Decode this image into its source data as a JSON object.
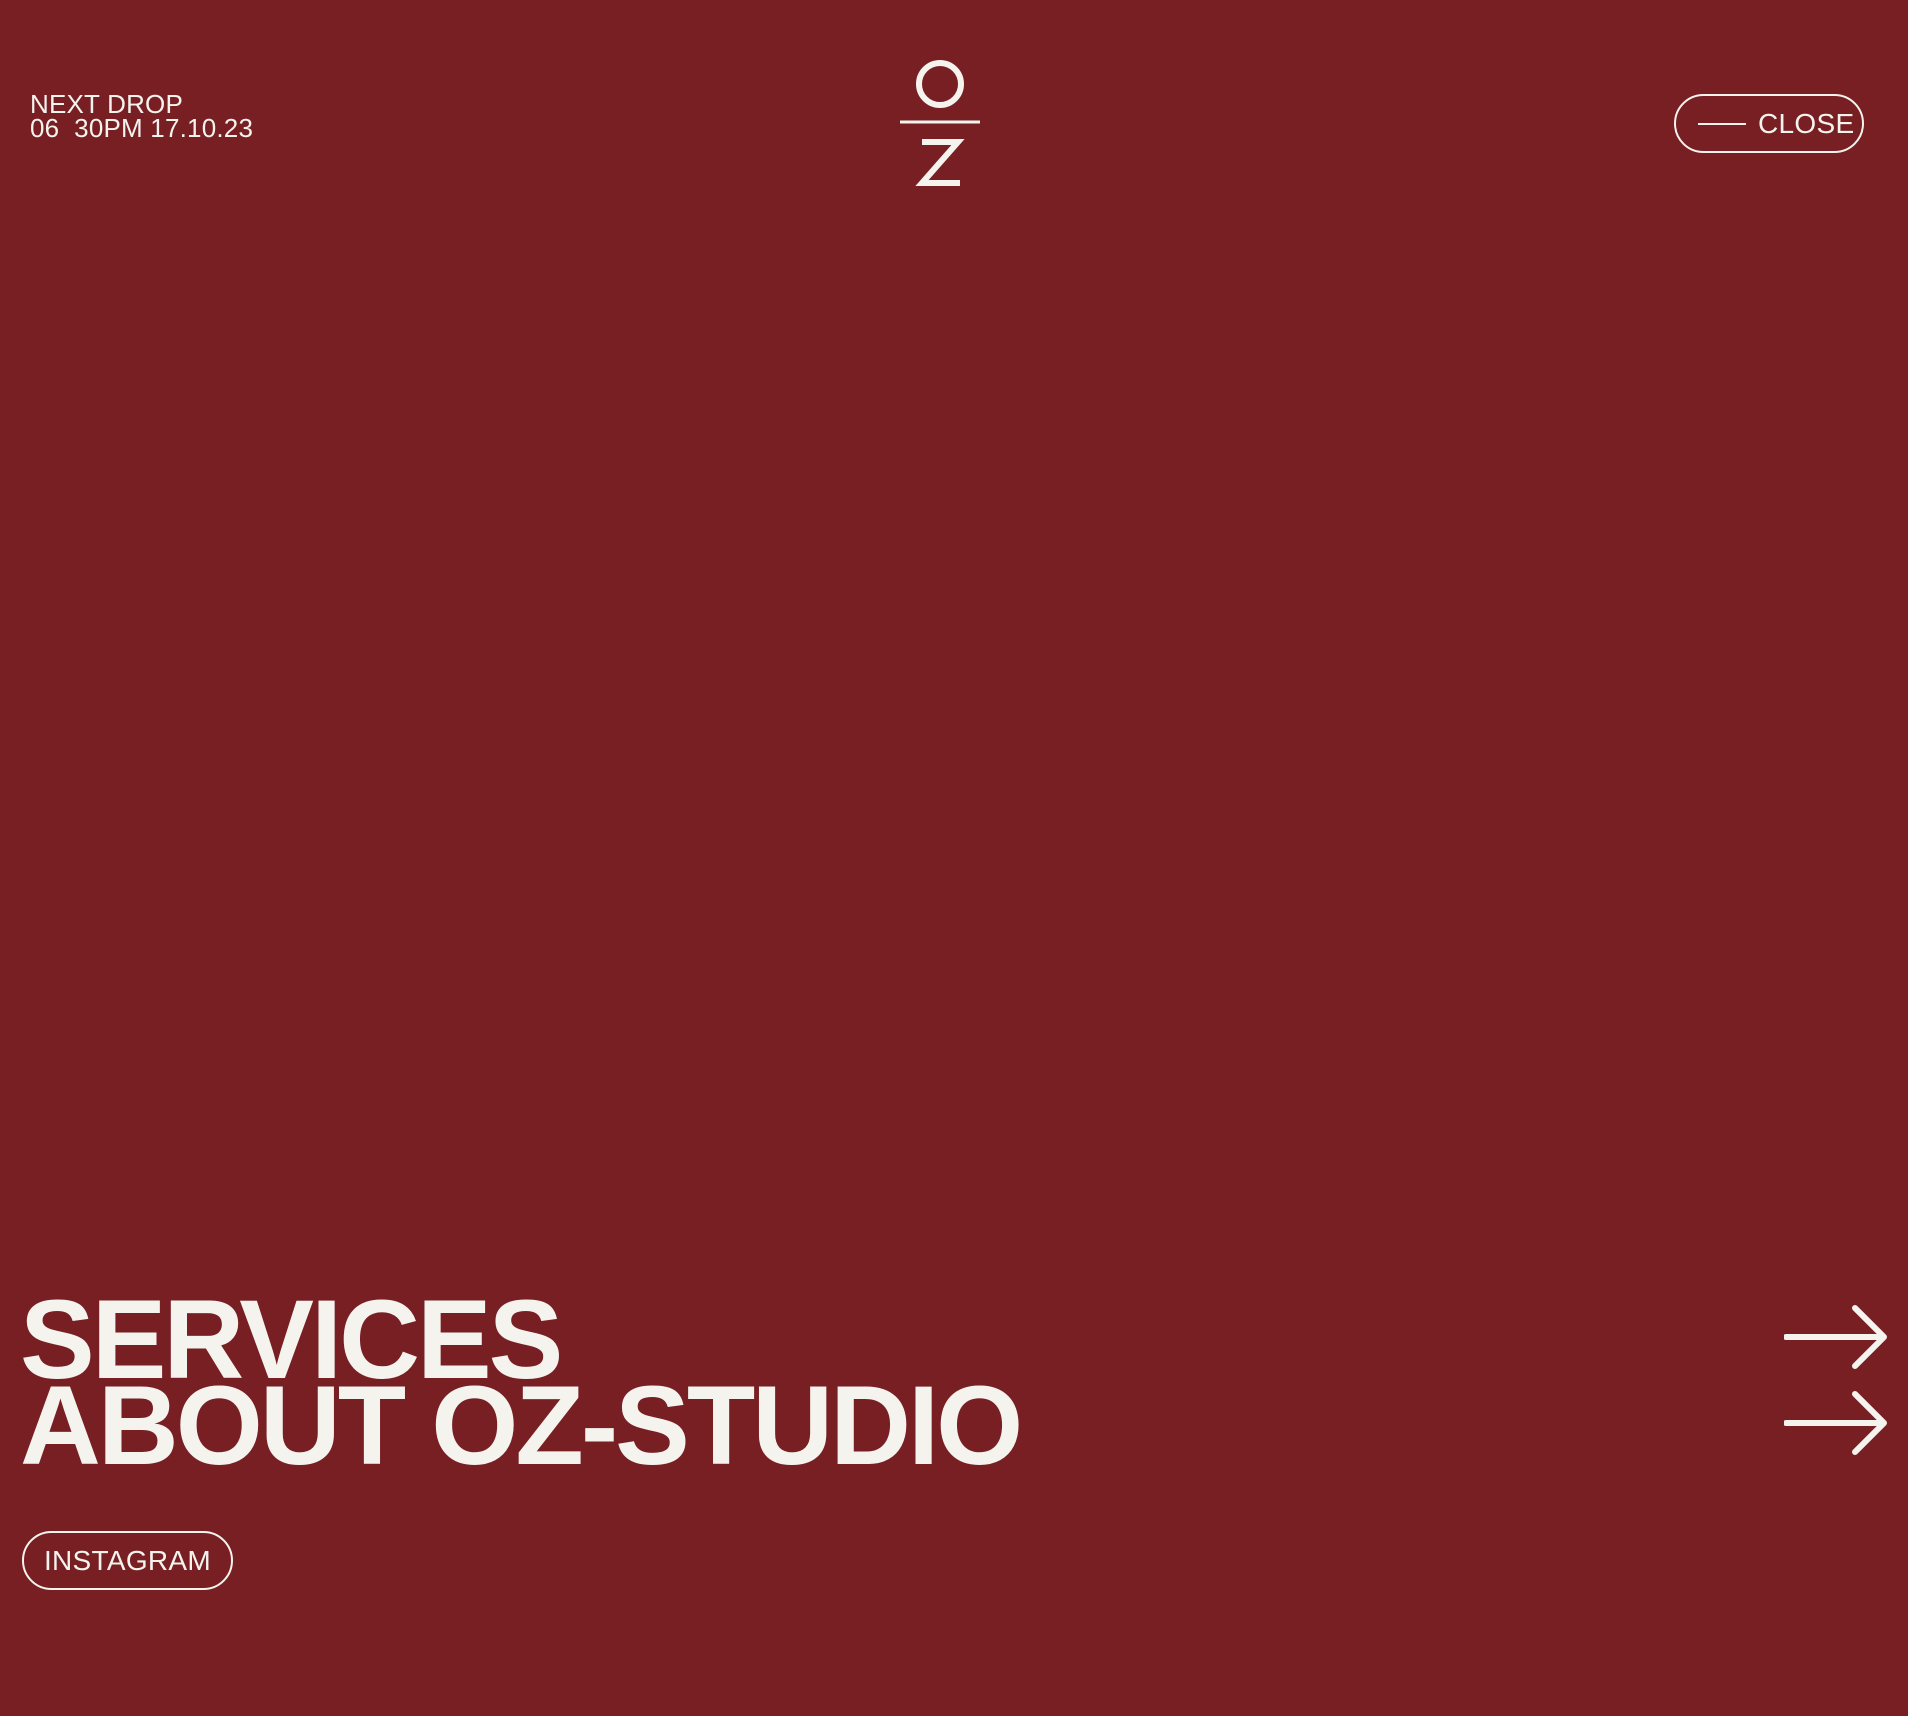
{
  "header": {
    "next_drop_label": "NEXT DROP",
    "next_drop_time": "06  30PM 17.10.23",
    "logo": {
      "top_letter": "O",
      "bottom_letter": "Z"
    },
    "close_label": "CLOSE"
  },
  "menu": {
    "items": [
      {
        "label": "SERVICES",
        "icon": "arrow-right-icon"
      },
      {
        "label": "ABOUT OZ-STUDIO",
        "icon": "arrow-right-icon"
      }
    ]
  },
  "footer": {
    "instagram_label": "INSTAGRAM"
  },
  "colors": {
    "background": "#781f24",
    "foreground": "#f5f3ee"
  }
}
